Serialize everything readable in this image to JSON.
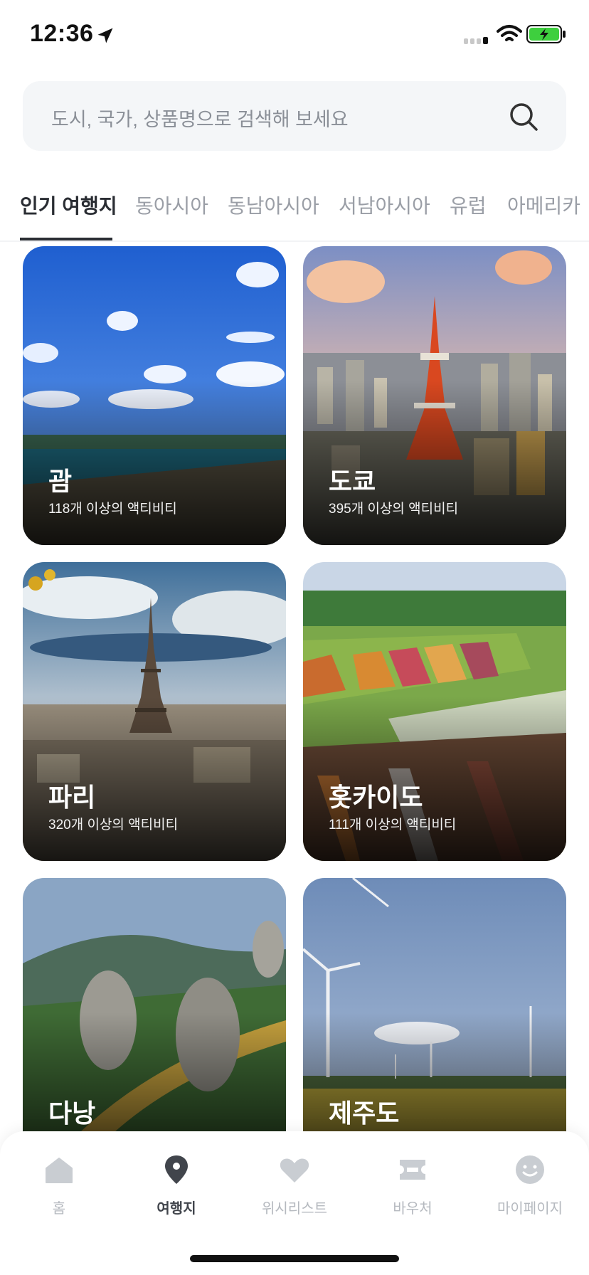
{
  "status_bar": {
    "time": "12:36",
    "icons": [
      "location-arrow-icon",
      "cellular-signal-icon",
      "wifi-icon",
      "battery-charging-icon"
    ],
    "battery_color": "#3ecf3e"
  },
  "search": {
    "placeholder": "도시, 국가, 상품명으로 검색해 보세요",
    "icon": "search-icon"
  },
  "tabs": [
    {
      "label": "인기 여행지",
      "active": true
    },
    {
      "label": "동아시아",
      "active": false
    },
    {
      "label": "동남아시아",
      "active": false
    },
    {
      "label": "서남아시아",
      "active": false
    },
    {
      "label": "유럽",
      "active": false
    },
    {
      "label": "아메리카",
      "active": false
    }
  ],
  "destinations": [
    {
      "name": "괌",
      "activities": "118개 이상의 액티비티"
    },
    {
      "name": "도쿄",
      "activities": "395개 이상의 액티비티"
    },
    {
      "name": "파리",
      "activities": "320개 이상의 액티비티"
    },
    {
      "name": "홋카이도",
      "activities": "111개 이상의 액티비티"
    },
    {
      "name": "다낭",
      "activities": ""
    },
    {
      "name": "제주도",
      "activities": ""
    }
  ],
  "bottom_nav": [
    {
      "label": "홈",
      "icon": "home-icon",
      "active": false
    },
    {
      "label": "여행지",
      "icon": "map-pin-icon",
      "active": true
    },
    {
      "label": "위시리스트",
      "icon": "heart-icon",
      "active": false
    },
    {
      "label": "바우처",
      "icon": "ticket-icon",
      "active": false
    },
    {
      "label": "마이페이지",
      "icon": "smiley-icon",
      "active": false
    }
  ],
  "colors": {
    "accent_text": "#2a2d33",
    "inactive_text": "#9a9ea6",
    "search_bg": "#f4f6f8"
  }
}
